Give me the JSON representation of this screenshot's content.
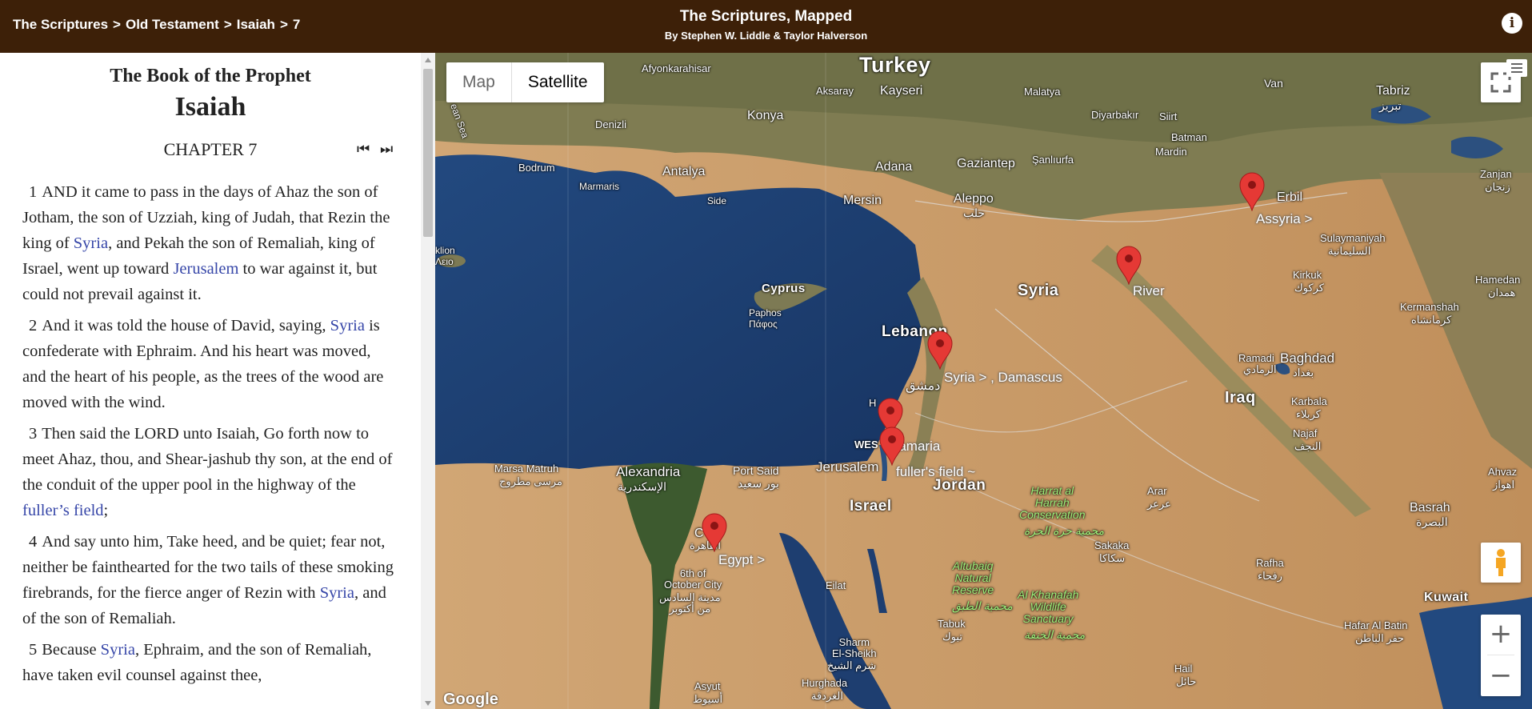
{
  "header": {
    "breadcrumbs": [
      "The Scriptures",
      "Old Testament",
      "Isaiah",
      "7"
    ],
    "separator": ">",
    "title": "The Scriptures, Mapped",
    "subtitle": "By Stephen W. Liddle & Taylor Halverson",
    "info_glyph": "i",
    "colors": {
      "header_bg": "#3d2008"
    }
  },
  "scripture": {
    "book_title": "The Book of the Prophet",
    "book_name": "Isaiah",
    "chapter_label": "CHAPTER 7",
    "prev_glyph": "⏮",
    "next_glyph": "⏭",
    "link_color": "#3646a8",
    "verses": [
      {
        "num": "1",
        "parts": [
          {
            "t": "AND it came to pass in the days of Ahaz the son of Jotham, the son of Uzziah, king of Judah, that Rezin the king of "
          },
          {
            "t": "Syria",
            "link": true
          },
          {
            "t": ", and Pekah the son of Remaliah, king of Israel, went up toward "
          },
          {
            "t": "Jerusalem",
            "link": true
          },
          {
            "t": " to war against it, but could not prevail against it."
          }
        ]
      },
      {
        "num": "2",
        "parts": [
          {
            "t": "And it was told the house of David, saying, "
          },
          {
            "t": "Syria",
            "link": true
          },
          {
            "t": " is confederate with Ephraim. And his heart was moved, and the heart of his people, as the trees of the wood are moved with the wind."
          }
        ]
      },
      {
        "num": "3",
        "parts": [
          {
            "t": "Then said the LORD unto Isaiah, Go forth now to meet Ahaz, thou, and Shear-jashub thy son, at the end of the conduit of the upper pool in the highway of the "
          },
          {
            "t": "fuller’s field",
            "link": true
          },
          {
            "t": ";"
          }
        ]
      },
      {
        "num": "4",
        "parts": [
          {
            "t": "And say unto him, Take heed, and be quiet; fear not, neither be fainthearted for the two tails of these smoking firebrands, for the fierce anger of Rezin with "
          },
          {
            "t": "Syria",
            "link": true
          },
          {
            "t": ", and of the son of Remaliah."
          }
        ]
      },
      {
        "num": "5",
        "parts": [
          {
            "t": "Because "
          },
          {
            "t": "Syria",
            "link": true
          },
          {
            "t": ", Ephraim, and the son of Remaliah, have taken evil counsel against thee,"
          }
        ]
      }
    ]
  },
  "map": {
    "map_type_buttons": {
      "map": "Map",
      "satellite": "Satellite",
      "selected": "Satellite"
    },
    "zoom_in": "+",
    "zoom_out": "−",
    "attribution": "Google",
    "marker_labels": {
      "assyria": "Assyria >",
      "river": "River",
      "damascus": "Syria > , Damascus",
      "samaria": "Samaria",
      "fullers_field": "fuller's field ~",
      "egypt": "Egypt >"
    },
    "labels": {
      "turkey": "Turkey",
      "syria": "Syria",
      "lebanon": "Lebanon",
      "iraq": "Iraq",
      "israel": "Israel",
      "jordan": "Jordan",
      "cyprus": "Cyprus",
      "kuwait": "Kuwait",
      "afyonkarahisar": "Afyonkarahisar",
      "aksaray": "Aksaray",
      "kayseri": "Kayseri",
      "malatya": "Malatya",
      "van": "Van",
      "tabriz": "Tabriz",
      "tabriz_ar": "تبریز",
      "zanjan": "Zanjan",
      "zanjan_ar": "زنجان",
      "denizli": "Denizli",
      "konya": "Konya",
      "diyarbakir": "Diyarbakır",
      "siirt": "Siirt",
      "batman": "Batman",
      "mardin": "Mardin",
      "bodrum": "Bodrum",
      "marmaris": "Marmaris",
      "antalya": "Antalya",
      "side": "Side",
      "mersin": "Mersin",
      "adana": "Adana",
      "gaziantep": "Gaziantep",
      "sanliurfa": "Şanlıurfa",
      "aleppo": "Aleppo",
      "aleppo_ar": "حلب",
      "erbil": "Erbil",
      "sulaymaniyah": "Sulaymaniyah",
      "sulaymaniyah_ar": "السليمانية",
      "kirkuk": "Kirkuk",
      "kirkuk_ar": "كركوك",
      "hamedan": "Hamedan",
      "hamedan_ar": "همدان",
      "kermanshah": "Kermanshah",
      "kermanshah_ar": "کرمانشاه",
      "paphos": "Paphos",
      "paphos_gr": "Πάφος",
      "ramadi": "Ramadi",
      "ramadi_ar": "الرمادي",
      "baghdad": "Baghdad",
      "baghdad_ar": "بغداد",
      "damascus_ar": "دمشق",
      "karbala": "Karbala",
      "karbala_ar": "كربلاء",
      "najaf": "Najaf",
      "najaf_ar": "النجف",
      "marsa_matruh": "Marsa Matruh",
      "marsa_matruh_ar": "مرسى مطروح",
      "alexandria": "Alexandria",
      "alexandria_ar": "الإسكندرية",
      "port_said": "Port Said",
      "port_said_ar": "بور سعيد",
      "jerusalem": "Jerusalem",
      "harrat": "Harrat al\nHarrah\nConservation",
      "harrat_ar": "محمية حرة الحرة",
      "arar": "Arar",
      "arar_ar": "عرعر",
      "sakaka": "Sakaka",
      "sakaka_ar": "سكاكا",
      "basrah": "Basrah",
      "basrah_ar": "البصرة",
      "ahvaz": "Ahvaz",
      "ahvaz_ar": "اهواز",
      "sixth_october": "6th of\nOctober City",
      "sixth_october_ar": "مدينة السادس\nمن أكتوبر",
      "eilat": "Eilat",
      "altubaiq": "Altubaiq\nNatural\nReserve",
      "altubaiq_ar": "محمية الطبق",
      "khanafah": "Al Khanafah\nWildlife\nSanctuary",
      "khanafah_ar": "محمية الخنفة",
      "rafha": "Rafha",
      "rafha_ar": "رفحاء",
      "hafar": "Hafar Al Batin",
      "hafar_ar": "حفر الباطن",
      "tabuk": "Tabuk",
      "tabuk_ar": "تبوك",
      "sharm": "Sharm\nEl-Sheikh",
      "sharm_ar": "شرم الشيخ",
      "hurghada": "Hurghada",
      "hurghada_ar": "الغردقة",
      "hail": "Hail",
      "hail_ar": "حائل",
      "asyut": "Asyut",
      "asyut_ar": "أسيوط",
      "klion": "klion\nΛειο",
      "sea": "ean Sea",
      "west": "WES",
      "hp": "H",
      "cairo_c": "C",
      "cairo_ar": "القاهرة"
    },
    "colors": {
      "marker": "#e53935",
      "desert": "#c79a68",
      "sea": "#1d3f73"
    }
  }
}
